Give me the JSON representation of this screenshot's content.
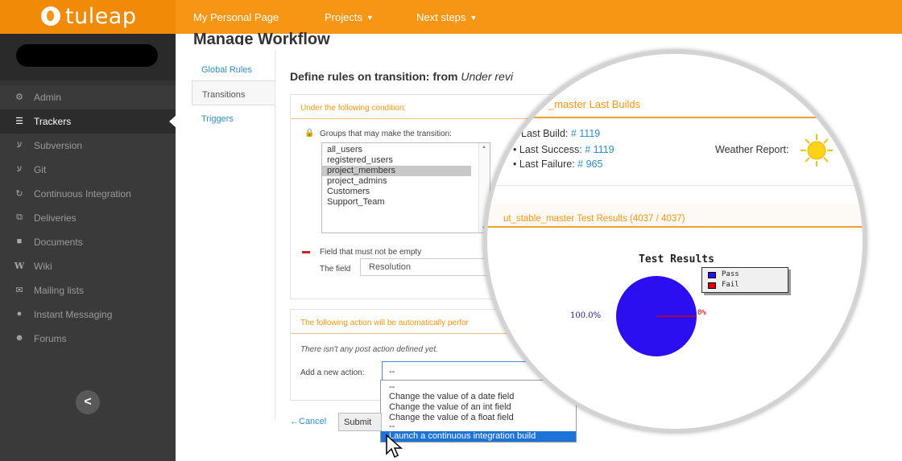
{
  "app": {
    "logo_text": "tuleap"
  },
  "topnav": {
    "items": [
      {
        "label": "My Personal Page"
      },
      {
        "label": "Projects"
      },
      {
        "label": "Next steps"
      }
    ]
  },
  "sidebar": {
    "items": [
      {
        "label": "Admin",
        "icon": "gears-icon"
      },
      {
        "label": "Trackers",
        "icon": "list-icon",
        "active": true
      },
      {
        "label": "Subversion",
        "icon": "subversion-icon"
      },
      {
        "label": "Git",
        "icon": "git-icon"
      },
      {
        "label": "Continuous Integration",
        "icon": "refresh-icon"
      },
      {
        "label": "Deliveries",
        "icon": "deliveries-icon"
      },
      {
        "label": "Documents",
        "icon": "folder-icon"
      },
      {
        "label": "Wiki",
        "icon": "wiki-icon"
      },
      {
        "label": "Mailing lists",
        "icon": "envelope-icon"
      },
      {
        "label": "Instant Messaging",
        "icon": "chat-icon"
      },
      {
        "label": "Forums",
        "icon": "users-icon"
      }
    ],
    "collapse_label": "<"
  },
  "main": {
    "title": "Manage Workflow",
    "tabs": [
      {
        "label": "Global Rules"
      },
      {
        "label": "Transitions",
        "active": true
      },
      {
        "label": "Triggers"
      }
    ],
    "section_title_prefix": "Define rules on transition: from",
    "section_title_from": "Under revi",
    "conditions": {
      "header": "Under the following condition:",
      "groups_label": "Groups that may make the transition:",
      "groups": [
        "all_users",
        "registered_users",
        "project_members",
        "project_admins",
        "Customers",
        "Support_Team"
      ],
      "selected_group": "project_members",
      "field_label": "Field that must not be empty",
      "the_field_label": "The field",
      "field_value": "Resolution"
    },
    "actions": {
      "header": "The following action will be automatically perfor",
      "no_action_text": "There isn't any post action defined yet.",
      "add_label": "Add a new action:",
      "select_value": "--",
      "options": [
        "--",
        "Change the value of a date field",
        "Change the value of an int field",
        "Change the value of a float field",
        "--",
        "Launch a continuous integration build"
      ],
      "highlighted_option": "Launch a continuous integration build"
    },
    "cancel_label": "←Cancel",
    "submit_label": "Submit"
  },
  "magnifier": {
    "builds_header": "_master Last Builds",
    "last_build_label": "Last Build:",
    "last_build_value": "# 1119",
    "last_success_label": "Last Success:",
    "last_success_value": "# 1119",
    "last_failure_label": "Last Failure:",
    "last_failure_value": "# 965",
    "weather_label": "Weather Report:",
    "weather_icon": "sun-icon",
    "tests_header": "ut_stable_master Test Results (4037 / 4037)"
  },
  "chart_data": {
    "type": "pie",
    "title": "Test Results",
    "series": [
      {
        "name": "Pass",
        "value": 100.0,
        "color": "#2b0ff0",
        "label": "100.0%"
      },
      {
        "name": "Fail",
        "value": 0.0,
        "color": "#e00000",
        "label": "0%"
      }
    ],
    "legend": "top-right"
  },
  "colors": {
    "brand_orange": "#f79514",
    "link_blue": "#2f8dc9",
    "sidebar_bg": "#3a3a3a",
    "highlight_blue": "#1e73d8"
  }
}
